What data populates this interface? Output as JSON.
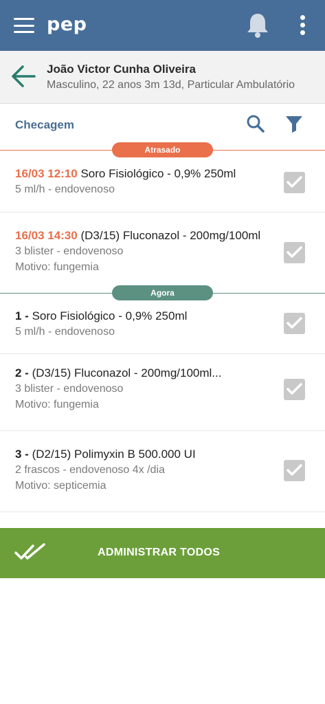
{
  "app": {
    "title": "pep"
  },
  "patient": {
    "name": "João Victor Cunha Oliveira",
    "info": "Masculino, 22 anos 3m 13d, Particular Ambulatório"
  },
  "toolbar": {
    "title": "Checagem"
  },
  "groups": {
    "late": {
      "label": "Atrasado",
      "color": "#e9704b"
    },
    "now": {
      "label": "Agora",
      "color": "#5c9182"
    }
  },
  "items": [
    {
      "prefix": "16/03 12:10",
      "title": " Soro Fisiológico - 0,9% 250ml",
      "sub1": "5 ml/h - endovenoso",
      "sub2": ""
    },
    {
      "prefix": "16/03 14:30",
      "title": " (D3/15) Fluconazol - 200mg/100ml",
      "sub1": "3 blister - endovenoso",
      "sub2": "Motivo: fungemia"
    },
    {
      "prefix": "1 -",
      "title": " Soro Fisiológico - 0,9% 250ml",
      "sub1": "5 ml/h - endovenoso",
      "sub2": ""
    },
    {
      "prefix": "2 -",
      "title": " (D3/15) Fluconazol - 200mg/100ml...",
      "sub1": "3 blister - endovenoso",
      "sub2": "Motivo: fungemia"
    },
    {
      "prefix": "3 -",
      "title": " (D2/15) Polimyxin B 500.000 UI",
      "sub1": "2 frascos - endovenoso 4x /dia",
      "sub2": "Motivo: septicemia"
    }
  ],
  "footer": {
    "admin_label": "ADMINISTRAR TODOS"
  },
  "icons": [
    "menu-icon",
    "bell-icon",
    "more-icon",
    "back-arrow-icon",
    "search-icon",
    "filter-icon",
    "checkbox-icon",
    "double-check-icon"
  ]
}
